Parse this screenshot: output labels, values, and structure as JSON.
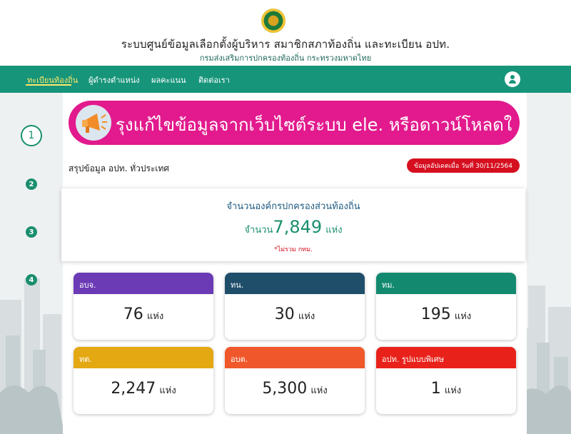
{
  "header": {
    "title": "ระบบศูนย์ข้อมูลเลือกตั้งผู้บริหาร สมาชิกสภาท้องถิ่น และทะเบียน อปท.",
    "subtitle": "กรมส่งเสริมการปกครองท้องถิ่น กระทรวงมหาดไทย"
  },
  "nav": {
    "items": [
      "ทะเบียนท้องถิ่น",
      "ผู้ดำรงตำแหน่ง",
      "ผลคะแนน",
      "ติดต่อเรา"
    ],
    "active_index": 0
  },
  "steps": [
    "1",
    "2",
    "3",
    "4"
  ],
  "banner": {
    "text": "รุงแก้ไขข้อมูลจากเว็บไซต์ระบบ ele. หรือดาวน์โหลดใ",
    "color": "#e21a8d"
  },
  "summary": {
    "label": "สรุปข้อมูล อปท. ทั่วประเทศ",
    "update_badge": "ข้อมูลอัปเดตเมื่อ วันที่ 30/11/2564"
  },
  "total": {
    "title": "จำนวนองค์กรปกครองส่วนท้องถิ่น",
    "label": "จำนวน",
    "value": "7,849",
    "unit": "แห่ง",
    "note": "*ไม่รวม กทม."
  },
  "cards": [
    {
      "name": "อบจ.",
      "value": "76",
      "unit": "แห่ง",
      "color": "#6a3bb5"
    },
    {
      "name": "ทน.",
      "value": "30",
      "unit": "แห่ง",
      "color": "#1f4e6b"
    },
    {
      "name": "ทม.",
      "value": "195",
      "unit": "แห่ง",
      "color": "#138a70"
    },
    {
      "name": "ทต.",
      "value": "2,247",
      "unit": "แห่ง",
      "color": "#e4a813"
    },
    {
      "name": "อบต.",
      "value": "5,300",
      "unit": "แห่ง",
      "color": "#f0582b"
    },
    {
      "name": "อปท. รูปแบบพิเศษ",
      "value": "1",
      "unit": "แห่ง",
      "color": "#e8221a"
    }
  ]
}
